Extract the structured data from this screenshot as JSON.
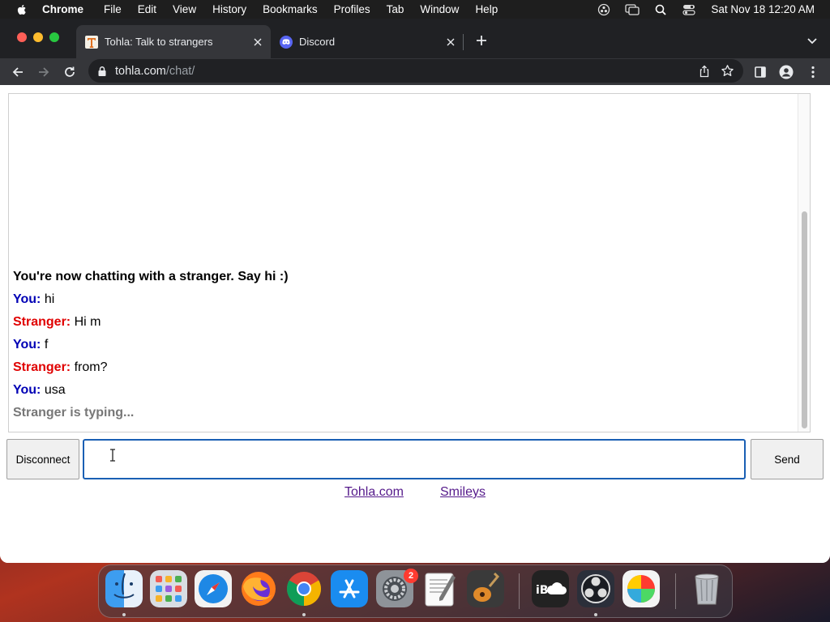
{
  "menubar": {
    "app_name": "Chrome",
    "items": [
      "File",
      "Edit",
      "View",
      "History",
      "Bookmarks",
      "Profiles",
      "Tab",
      "Window",
      "Help"
    ],
    "clock": "Sat Nov 18  12:20 AM"
  },
  "browser": {
    "tabs": [
      {
        "title": "Tohla: Talk to strangers",
        "active": true
      },
      {
        "title": "Discord",
        "active": false
      }
    ],
    "url_host": "tohla.com",
    "url_path": "/chat/"
  },
  "chat": {
    "status": "You're now chatting with a stranger. Say hi :)",
    "messages": [
      {
        "sender": "You:",
        "text": "hi"
      },
      {
        "sender": "Stranger:",
        "text": "Hi m"
      },
      {
        "sender": "You:",
        "text": "f"
      },
      {
        "sender": "Stranger:",
        "text": "from?"
      },
      {
        "sender": "You:",
        "text": "usa"
      }
    ],
    "typing": "Stranger is typing...",
    "colors": {
      "you": "#0000b5",
      "stranger": "#e00000",
      "typing": "#777777"
    }
  },
  "controls": {
    "disconnect_label": "Disconnect",
    "message_value": "",
    "send_label": "Send"
  },
  "footer": {
    "links": [
      "Tohla.com",
      "Smileys"
    ]
  },
  "dock": {
    "apps": [
      "finder-icon",
      "launchpad-icon",
      "safari-icon",
      "firefox-icon",
      "chrome-icon",
      "app-store-icon",
      "system-settings-icon",
      "textedit-icon",
      "garageband-icon",
      "icloud-icon",
      "obs-icon",
      "color-picker-icon",
      "trash-icon"
    ],
    "settings_badge": "2"
  }
}
